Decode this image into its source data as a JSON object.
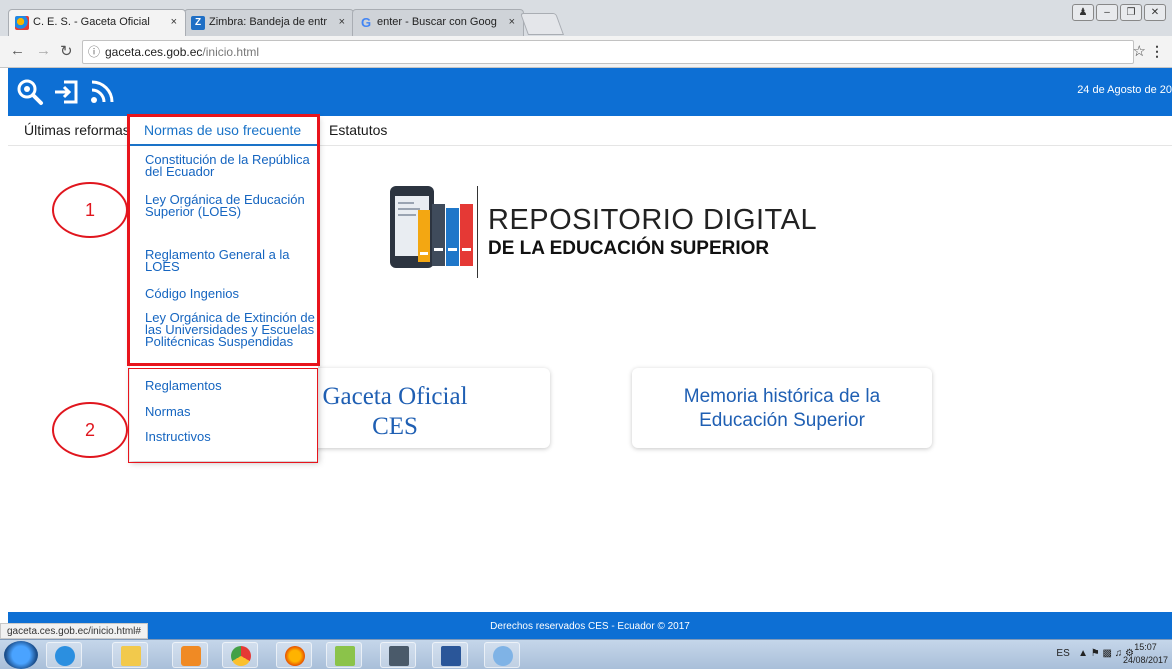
{
  "browser": {
    "tabs": [
      {
        "title": "C. E. S. - Gaceta Oficial",
        "close": "×"
      },
      {
        "title": "Zimbra: Bandeja de entr",
        "close": "×"
      },
      {
        "title": "enter - Buscar con Goog",
        "close": "×"
      }
    ],
    "url_host": "gaceta.ces.gob.ec",
    "url_path": "/inicio.html",
    "status_url": "gaceta.ces.gob.ec/inicio.html#"
  },
  "header": {
    "date": "24 de Agosto de 20",
    "color": "#0d6fd4"
  },
  "menu": {
    "ultimas_reformas": "Últimas reformas",
    "normas_frecuente": "Normas de uso frecuente",
    "estatutos": "Estatutos"
  },
  "dropdown": {
    "items_group1": [
      "Constitución de la República del Ecuador",
      "Ley Orgánica de Educación Superior (LOES)",
      "Reglamento General a la LOES",
      "Código Ingenios",
      "Ley Orgánica de Extinción de las Universidades y Escuelas Politécnicas Suspendidas"
    ],
    "items_group2": [
      "Reglamentos",
      "Normas",
      "Instructivos"
    ]
  },
  "annotations": {
    "circle1": "1",
    "circle2": "2",
    "highlight_color": "#e8141c"
  },
  "logo": {
    "title": "REPOSITORIO DIGITAL",
    "subtitle": "DE LA EDUCACIÓN SUPERIOR"
  },
  "cards": {
    "gaceta": {
      "line1": "Gaceta Oficial",
      "line2": "CES"
    },
    "memoria": {
      "line1": "Memoria histórica de la",
      "line2": "Educación Superior"
    }
  },
  "footer": {
    "text": "Derechos reservados CES - Ecuador © 2017"
  },
  "taskbar": {
    "language": "ES",
    "time": "15:07",
    "date": "24/08/2017"
  }
}
